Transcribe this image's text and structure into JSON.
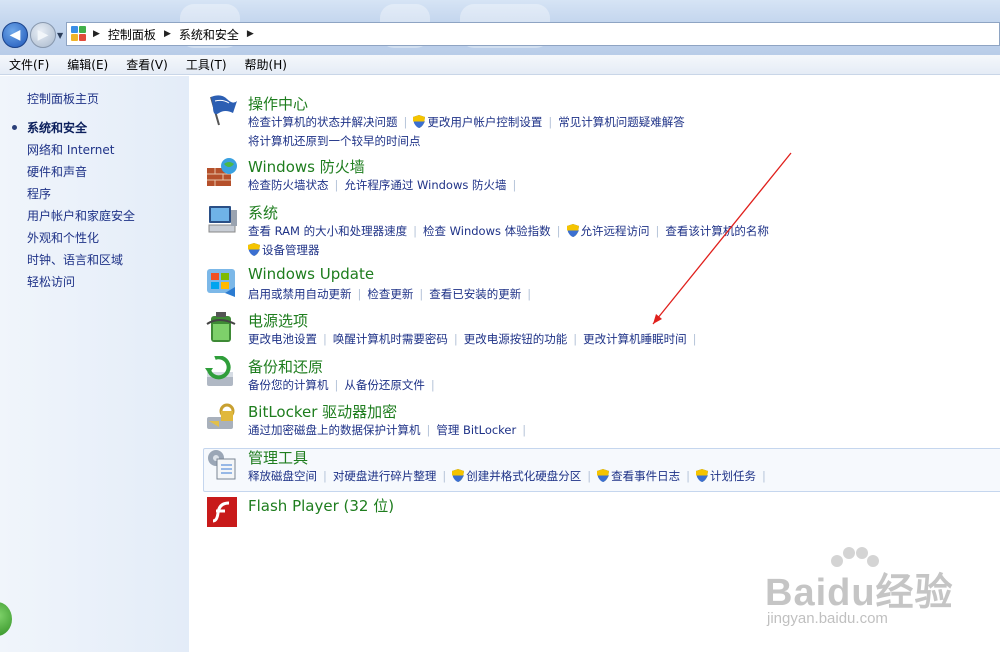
{
  "breadcrumbs": [
    "控制面板",
    "系统和安全"
  ],
  "menu": [
    "文件(F)",
    "编辑(E)",
    "查看(V)",
    "工具(T)",
    "帮助(H)"
  ],
  "left_nav": {
    "home": "控制面板主页",
    "items": [
      "系统和安全",
      "网络和 Internet",
      "硬件和声音",
      "程序",
      "用户帐户和家庭安全",
      "外观和个性化",
      "时钟、语言和区域",
      "轻松访问"
    ]
  },
  "categories": [
    {
      "title": "操作中心",
      "icon": "flag-icon",
      "links": [
        {
          "text": "检查计算机的状态并解决问题",
          "shield": false
        },
        {
          "text": "更改用户帐户控制设置",
          "shield": true
        },
        {
          "text": "常见计算机问题疑难解答",
          "shield": false
        },
        {
          "text": "将计算机还原到一个较早的时间点",
          "shield": false
        }
      ]
    },
    {
      "title": "Windows 防火墙",
      "icon": "firewall-icon",
      "links": [
        {
          "text": "检查防火墙状态",
          "shield": false
        },
        {
          "text": "允许程序通过 Windows 防火墙",
          "shield": false
        }
      ]
    },
    {
      "title": "系统",
      "icon": "computer-icon",
      "links": [
        {
          "text": "查看 RAM 的大小和处理器速度",
          "shield": false
        },
        {
          "text": "检查 Windows 体验指数",
          "shield": false
        },
        {
          "text": "允许远程访问",
          "shield": true
        },
        {
          "text": "查看该计算机的名称",
          "shield": false
        },
        {
          "text": "设备管理器",
          "shield": true
        }
      ]
    },
    {
      "title": "Windows Update",
      "icon": "windows-update-icon",
      "links": [
        {
          "text": "启用或禁用自动更新",
          "shield": false
        },
        {
          "text": "检查更新",
          "shield": false
        },
        {
          "text": "查看已安装的更新",
          "shield": false
        }
      ]
    },
    {
      "title": "电源选项",
      "icon": "battery-icon",
      "links": [
        {
          "text": "更改电池设置",
          "shield": false
        },
        {
          "text": "唤醒计算机时需要密码",
          "shield": false
        },
        {
          "text": "更改电源按钮的功能",
          "shield": false
        },
        {
          "text": "更改计算机睡眠时间",
          "shield": false
        }
      ]
    },
    {
      "title": "备份和还原",
      "icon": "backup-icon",
      "links": [
        {
          "text": "备份您的计算机",
          "shield": false
        },
        {
          "text": "从备份还原文件",
          "shield": false
        }
      ]
    },
    {
      "title": "BitLocker 驱动器加密",
      "icon": "bitlocker-icon",
      "links": [
        {
          "text": "通过加密磁盘上的数据保护计算机",
          "shield": false
        },
        {
          "text": "管理 BitLocker",
          "shield": false
        }
      ]
    },
    {
      "title": "管理工具",
      "icon": "admin-tools-icon",
      "links": [
        {
          "text": "释放磁盘空间",
          "shield": false
        },
        {
          "text": "对硬盘进行碎片整理",
          "shield": false
        },
        {
          "text": "创建并格式化硬盘分区",
          "shield": true
        },
        {
          "text": "查看事件日志",
          "shield": true
        },
        {
          "text": "计划任务",
          "shield": true
        }
      ]
    },
    {
      "title": "Flash Player (32 位)",
      "icon": "flash-icon",
      "links": []
    }
  ],
  "watermark": {
    "big": "Baidu经验",
    "small": "jingyan.baidu.com"
  },
  "colors": {
    "link": "#1e3287",
    "category_title": "#1e7d1e",
    "annotation_arrow": "#e0201c"
  }
}
